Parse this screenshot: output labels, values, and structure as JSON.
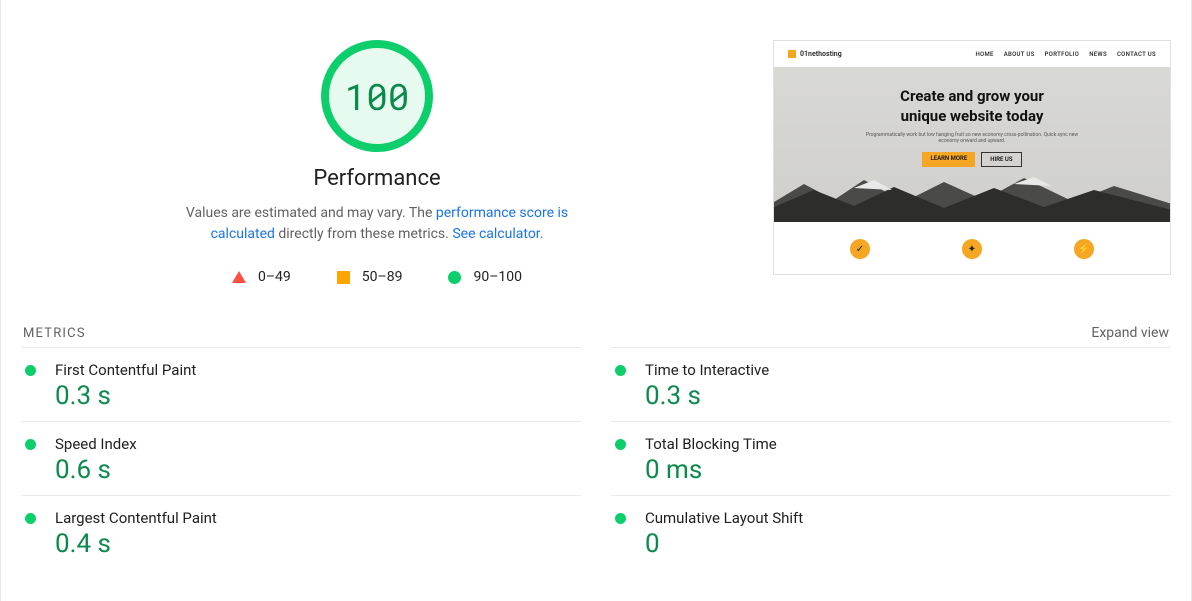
{
  "gauge": {
    "score": "100",
    "title": "Performance"
  },
  "subtext": {
    "prefix": "Values are estimated and may vary. The ",
    "link1": "performance score is calculated",
    "mid": " directly from these metrics. ",
    "link2": "See calculator."
  },
  "legend": {
    "fail": "0–49",
    "avg": "50–89",
    "pass": "90–100"
  },
  "preview": {
    "logo": "01nethosting",
    "nav": [
      "HOME",
      "ABOUT US",
      "PORTFOLIO",
      "NEWS",
      "CONTACT US"
    ],
    "hero_l1": "Create and grow your",
    "hero_l2": "unique website today",
    "hero_p": "Programmatically work but low hanging fruit so new economy cross-pollination. Quick sync new economy onward and upward.",
    "btn1": "LEARN MORE",
    "btn2": "HIRE US"
  },
  "metrics_label": "METRICS",
  "expand_label": "Expand view",
  "metrics": [
    {
      "name": "First Contentful Paint",
      "value": "0.3 s"
    },
    {
      "name": "Time to Interactive",
      "value": "0.3 s"
    },
    {
      "name": "Speed Index",
      "value": "0.6 s"
    },
    {
      "name": "Total Blocking Time",
      "value": "0 ms"
    },
    {
      "name": "Largest Contentful Paint",
      "value": "0.4 s"
    },
    {
      "name": "Cumulative Layout Shift",
      "value": "0"
    }
  ]
}
